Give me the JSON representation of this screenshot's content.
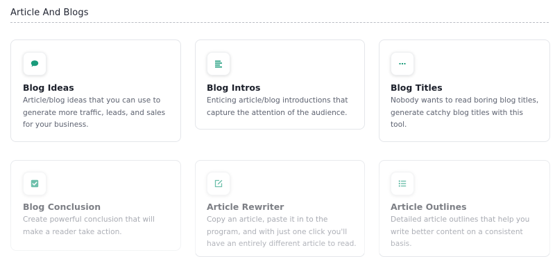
{
  "section": {
    "title": "Article And Blogs"
  },
  "accent_color": "#1a9b7b",
  "cards": [
    {
      "title": "Blog Ideas",
      "description": "Article/blog ideas that you can use to generate more traffic, leads, and sales for your business.",
      "icon": "chat-bubble-icon"
    },
    {
      "title": "Blog Intros",
      "description": "Enticing article/blog introductions that capture the attention of the audience.",
      "icon": "align-left-icon"
    },
    {
      "title": "Blog Titles",
      "description": "Nobody wants to read boring blog titles, generate catchy blog titles with this tool.",
      "icon": "ellipsis-icon"
    },
    {
      "title": "Blog Conclusion",
      "description": "Create powerful conclusion that will make a reader take action.",
      "icon": "check-square-icon"
    },
    {
      "title": "Article Rewriter",
      "description": "Copy an article, paste it in to the program, and with just one click you'll have an entirely different article to read.",
      "icon": "edit-icon"
    },
    {
      "title": "Article Outlines",
      "description": "Detailed article outlines that help you write better content on a consistent basis.",
      "icon": "list-icon"
    }
  ]
}
